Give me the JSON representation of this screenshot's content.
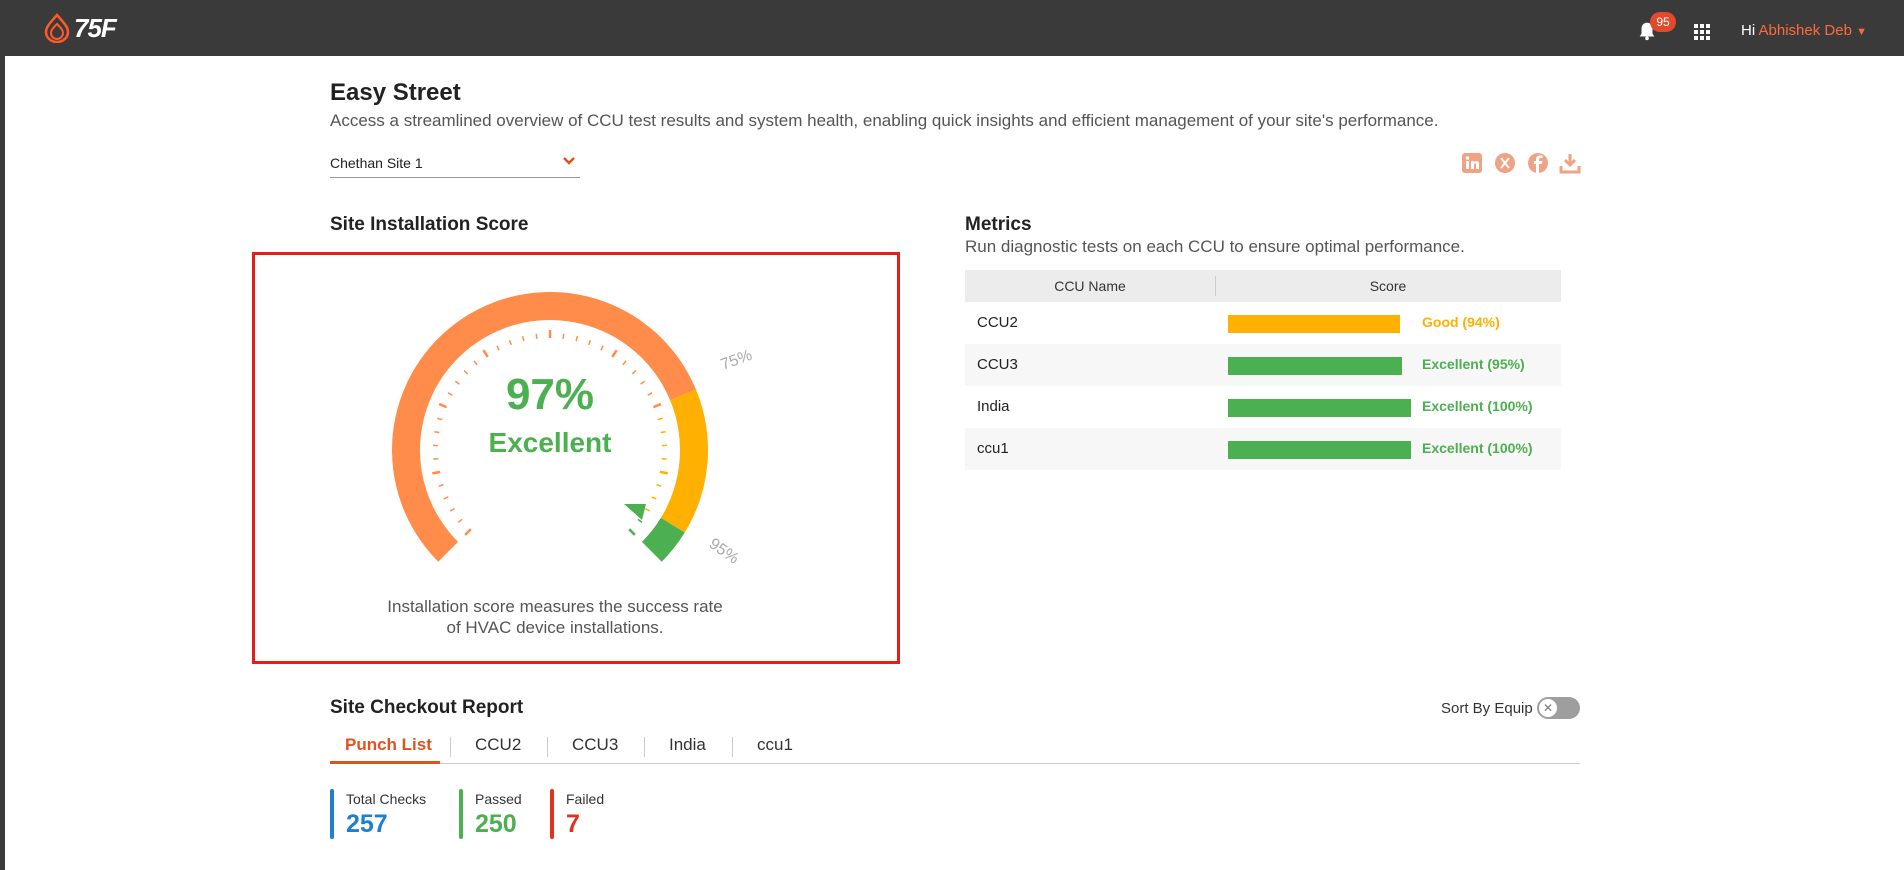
{
  "topbar": {
    "logo_text": "75F",
    "notification_count": "95",
    "greeting": "Hi",
    "user_name": "Abhishek Deb"
  },
  "header": {
    "title": "Easy Street",
    "description": "Access a streamlined overview of CCU test results and system health, enabling quick insights and efficient management of your site's performance.",
    "site_selector": {
      "value": "Chethan Site 1"
    },
    "share_icons": [
      "linkedin-icon",
      "x-icon",
      "facebook-icon",
      "download-icon"
    ]
  },
  "installation_score": {
    "title": "Site Installation Score",
    "score_text": "97%",
    "score_value": 97,
    "rating": "Excellent",
    "threshold_75": "75%",
    "threshold_95": "95%",
    "description_line1": "Installation score measures the success rate",
    "description_line2": "of HVAC device installations.",
    "colors": {
      "low": "#ff8c4a",
      "good": "#ffb000",
      "excellent": "#4caf50"
    }
  },
  "metrics": {
    "title": "Metrics",
    "description": "Run diagnostic tests on each CCU to ensure optimal performance.",
    "columns": [
      "CCU Name",
      "Score"
    ],
    "rows": [
      {
        "name": "CCU2",
        "score": 94,
        "status": "Good (94%)",
        "color": "#ffb000"
      },
      {
        "name": "CCU3",
        "score": 95,
        "status": "Excellent (95%)",
        "color": "#4caf50"
      },
      {
        "name": "India",
        "score": 100,
        "status": "Excellent (100%)",
        "color": "#4caf50"
      },
      {
        "name": "ccu1",
        "score": 100,
        "status": "Excellent (100%)",
        "color": "#4caf50"
      }
    ]
  },
  "checkout_report": {
    "title": "Site Checkout Report",
    "sort_label": "Sort By Equip",
    "tabs": [
      "Punch List",
      "CCU2",
      "CCU3",
      "India",
      "ccu1"
    ],
    "stats": [
      {
        "label": "Total Checks",
        "value": "257",
        "color": "#1e7fcf"
      },
      {
        "label": "Passed",
        "value": "250",
        "color": "#4caf50"
      },
      {
        "label": "Failed",
        "value": "7",
        "color": "#e0321f"
      }
    ]
  }
}
